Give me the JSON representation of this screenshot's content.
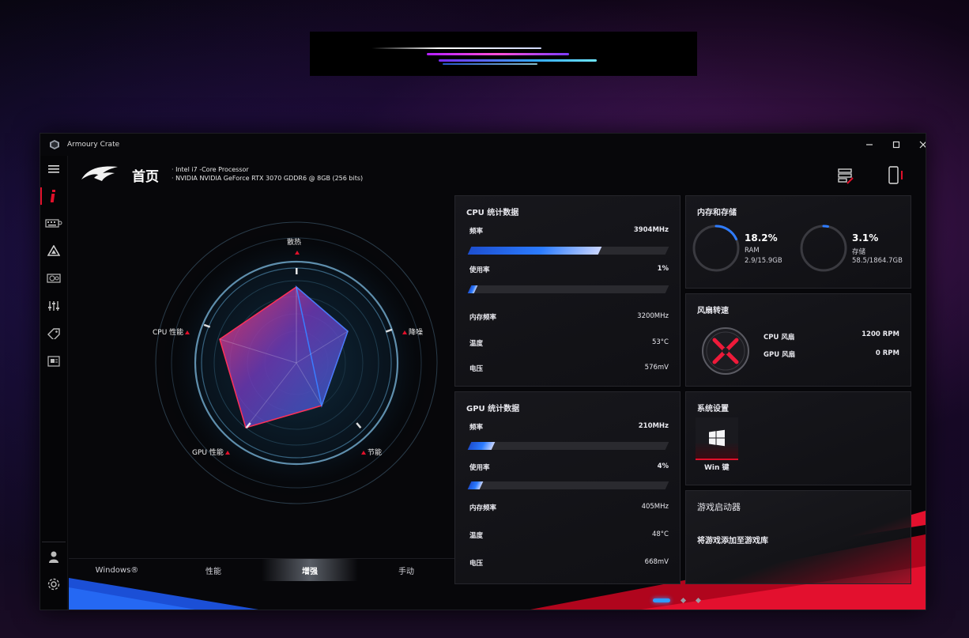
{
  "window": {
    "title": "Armoury Crate"
  },
  "header": {
    "page_title": "首页",
    "specs": [
      "Intel i7 -Core Processor",
      "NVIDIA NVIDIA GeForce RTX 3070 GDDR6 @ 8GB (256 bits)"
    ]
  },
  "radar": {
    "labels": {
      "top": "散热",
      "right": "降噪",
      "bottom_right": "节能",
      "bottom_left": "GPU 性能",
      "left": "CPU 性能"
    }
  },
  "modes": {
    "items": [
      "Windows®",
      "性能",
      "增强",
      "手动"
    ],
    "active": "增强"
  },
  "cpu_stats": {
    "title": "CPU 统计数据",
    "freq_label": "频率",
    "freq_value": "3904MHz",
    "freq_fill": 0.66,
    "usage_label": "使用率",
    "usage_value": "1%",
    "usage_fill": 0.01,
    "memfreq_label": "内存频率",
    "memfreq_value": "3200MHz",
    "temp_label": "温度",
    "temp_value": "53°C",
    "volt_label": "电压",
    "volt_value": "576mV"
  },
  "gpu_stats": {
    "title": "GPU 统计数据",
    "freq_label": "频率",
    "freq_value": "210MHz",
    "freq_fill": 0.12,
    "usage_label": "使用率",
    "usage_value": "4%",
    "usage_fill": 0.06,
    "memfreq_label": "内存频率",
    "memfreq_value": "405MHz",
    "temp_label": "温度",
    "temp_value": "48°C",
    "volt_label": "电压",
    "volt_value": "668mV"
  },
  "memory": {
    "title": "内存和存储",
    "ram": {
      "percent": "18.2%",
      "label": "RAM",
      "detail": "2.9/15.9GB",
      "fill": 0.182
    },
    "storage": {
      "percent": "3.1%",
      "label": "存储",
      "detail": "58.5/1864.7GB",
      "fill": 0.031
    }
  },
  "fans": {
    "title": "风扇转速",
    "cpu_label": "CPU 风扇",
    "cpu_value": "1200 RPM",
    "gpu_label": "GPU 风扇",
    "gpu_value": "0 RPM"
  },
  "system": {
    "title": "系统设置",
    "win_key_label": "Win 键"
  },
  "launcher": {
    "title": "游戏启动器",
    "add_text": "将游戏添加至游戏库"
  },
  "colors": {
    "accent_red": "#e0102a",
    "accent_blue": "#2f7cff"
  }
}
